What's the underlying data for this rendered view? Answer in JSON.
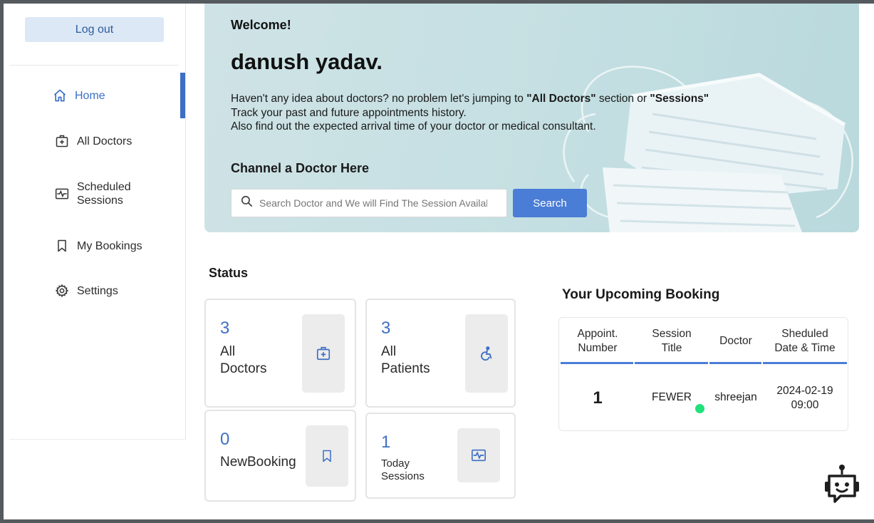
{
  "sidebar": {
    "logout_label": "Log out",
    "items": [
      {
        "label": "Home",
        "icon": "home-icon",
        "active": true
      },
      {
        "label": "All Doctors",
        "icon": "medical-case-icon"
      },
      {
        "label": "Scheduled Sessions",
        "icon": "pulse-icon"
      },
      {
        "label": "My Bookings",
        "icon": "bookmark-icon"
      },
      {
        "label": "Settings",
        "icon": "gear-icon"
      }
    ]
  },
  "hero": {
    "welcome": "Welcome!",
    "user_name": "danush yadav.",
    "line1_pre": "Haven't any idea about doctors? no problem let's jumping to ",
    "line1_doctors": "\"All Doctors\"",
    "line1_mid": " section or ",
    "line1_sessions": "\"Sessions\"",
    "line2": "Track your past and future appointments history.",
    "line3": "Also find out the expected arrival time of your doctor or medical consultant.",
    "channel_title": "Channel a Doctor Here",
    "search_placeholder": "Search Doctor and We will Find The Session Available",
    "search_button": "Search"
  },
  "status": {
    "title": "Status",
    "cards": [
      {
        "value": "3",
        "label_line1": "All",
        "label_line2": "Doctors",
        "icon": "medical-case-icon"
      },
      {
        "value": "3",
        "label_line1": "All",
        "label_line2": "Patients",
        "icon": "wheelchair-icon"
      },
      {
        "value": "0",
        "label": "NewBooking",
        "icon": "bookmark-icon"
      },
      {
        "value": "1",
        "label_line1": "Today",
        "label_line2": "Sessions",
        "icon": "pulse-icon"
      }
    ]
  },
  "upcoming": {
    "title": "Your Upcoming Booking",
    "headers": [
      {
        "l1": "Appoint.",
        "l2": "Number"
      },
      {
        "l1": "Session",
        "l2": "Title"
      },
      {
        "l1": "Doctor",
        "l2": ""
      },
      {
        "l1": "Sheduled",
        "l2": "Date & Time"
      }
    ],
    "rows": [
      {
        "number": "1",
        "session": "FEWER",
        "doctor": "shreejan",
        "date": "2024-02-19",
        "time": "09:00"
      }
    ]
  },
  "chatbot": {
    "icon": "robot-icon"
  },
  "colors": {
    "accent": "#4a7dd6",
    "active": "#3d6fc4",
    "online": "#22e07a",
    "hero_bg": "#c4dfe2"
  }
}
